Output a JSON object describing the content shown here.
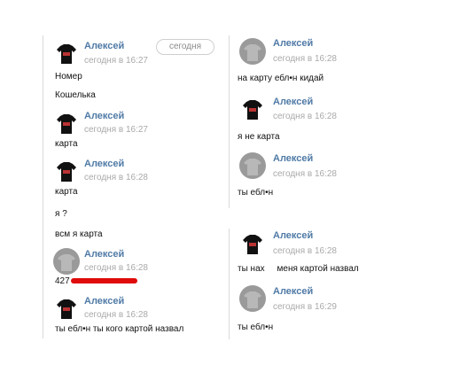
{
  "today_badge": "сегодня",
  "left": {
    "messages": [
      {
        "name": "Алексей",
        "time": "сегодня в 16:27",
        "lines": [
          "Номер",
          "Кошелька"
        ]
      },
      {
        "name": "Алексей",
        "time": "сегодня в 16:27",
        "lines": [
          "карта"
        ]
      },
      {
        "name": "Алексей",
        "time": "сегодня в 16:28",
        "lines": [
          "карта",
          "я ?",
          "всм я карта"
        ]
      },
      {
        "name": "Алексей",
        "time": "сегодня в 16:28",
        "lines": [
          "427"
        ]
      },
      {
        "name": "Алексей",
        "time": "сегодня в 16:28",
        "lines": [
          "ты ебл•н ты кого картой назвал"
        ]
      }
    ]
  },
  "right": {
    "messages": [
      {
        "name": "Алексей",
        "time": "сегодня в 16:28",
        "lines": [
          "на карту ебл•н кидай"
        ]
      },
      {
        "name": "Алексей",
        "time": "сегодня в 16:28",
        "lines": [
          "я не карта"
        ]
      },
      {
        "name": "Алексей",
        "time": "сегодня в 16:28",
        "lines": [
          "ты ебл•н"
        ]
      },
      {
        "name": "Алексей",
        "time": "сегодня в 16:28",
        "lines": [
          "ты нах     меня картой назвал"
        ]
      },
      {
        "name": "Алексей",
        "time": "сегодня в 16:29",
        "lines": [
          "ты ебл•н"
        ]
      }
    ]
  },
  "colors": {
    "name": "#4f7aa6",
    "time": "#a9a9a9",
    "redaction": "#e00b0b"
  },
  "icons": {
    "tee_avatar": "tshirt-avatar-icon",
    "grey_avatar": "grey-user-avatar-icon"
  }
}
